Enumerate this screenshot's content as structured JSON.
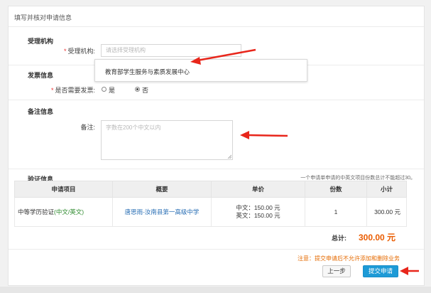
{
  "page": {
    "title": "填写并核对申请信息"
  },
  "agency": {
    "section": "受理机构",
    "label": "受理机构:",
    "placeholder": "请选择受理机构",
    "dropdown_option": "教育部学生服务与素质发展中心"
  },
  "invoice": {
    "section": "发票信息",
    "label": "是否需要发票:",
    "options": [
      "是",
      "否"
    ],
    "selected": "否"
  },
  "remarks": {
    "section": "备注信息",
    "label": "备注:",
    "placeholder": "字数在200个中文以内"
  },
  "verification": {
    "section": "验证信息",
    "note": "一个申请单申请的中英文项目份数总计不能超过30。",
    "columns": [
      "申请项目",
      "概要",
      "单价",
      "份数",
      "小计"
    ],
    "rows": [
      {
        "item_main": "中等学历验证",
        "item_lang": "(中文/英文)",
        "summary": "唐思雨-汝南县第一高级中学",
        "price_cn": "中文：150.00 元",
        "price_en": "英文：150.00 元",
        "quantity": "1",
        "subtotal": "300.00 元"
      }
    ],
    "total_label": "总计:",
    "total_value": "300.00 元"
  },
  "footer": {
    "warning": "注意：提交申请后不允许添加和删除业务",
    "prev_button": "上一步",
    "submit_button": "提交申请"
  },
  "colors": {
    "accent": "#1d9ad6",
    "total": "#ea5c00",
    "warning": "#e56a00",
    "arrow": "#e8261b",
    "green_text": "#2d8a2d",
    "blue_link": "#2a6fb5"
  }
}
